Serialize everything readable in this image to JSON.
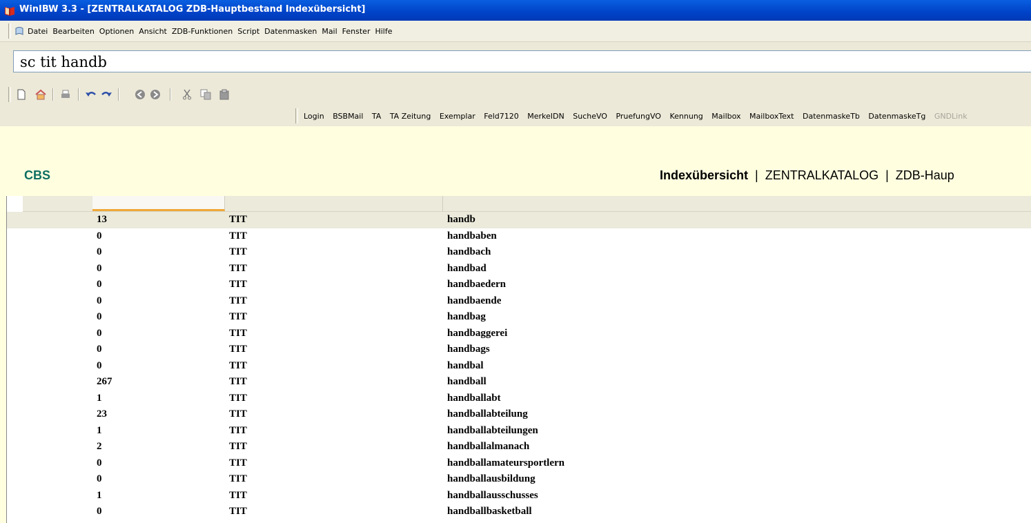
{
  "window": {
    "title": "WinIBW 3.3 - [ZENTRALKATALOG ZDB-Hauptbestand Indexübersicht]"
  },
  "menu": [
    "Datei",
    "Bearbeiten",
    "Optionen",
    "Ansicht",
    "ZDB-Funktionen",
    "Script",
    "Datenmasken",
    "Mail",
    "Fenster",
    "Hilfe"
  ],
  "command": {
    "value": "sc tit handb"
  },
  "toolbar": [
    "new-icon",
    "home-icon",
    "print-icon",
    "undo-icon",
    "redo-icon",
    "back-icon",
    "forward-icon",
    "cut-icon",
    "copy-icon",
    "paste-icon"
  ],
  "links": [
    "Login",
    "BSBMail",
    "TA",
    "TA Zeitung",
    "Exemplar",
    "Feld7120",
    "MerkeIDN",
    "SucheVO",
    "PruefungVO",
    "Kennung",
    "Mailbox",
    "MailboxText",
    "DatenmaskeTb",
    "DatenmaskeTg",
    "GNDLink"
  ],
  "content": {
    "system": "CBS",
    "breadcrumb": {
      "view": "Indexübersicht",
      "sep": "|",
      "catalog": "ZENTRALKATALOG",
      "sep2": "|",
      "database": "ZDB-Haup"
    }
  },
  "index_rows": [
    {
      "count": "13",
      "index": "TIT",
      "term": "handb"
    },
    {
      "count": "0",
      "index": "TIT",
      "term": "handbaben"
    },
    {
      "count": "0",
      "index": "TIT",
      "term": "handbach"
    },
    {
      "count": "0",
      "index": "TIT",
      "term": "handbad"
    },
    {
      "count": "0",
      "index": "TIT",
      "term": "handbaedern"
    },
    {
      "count": "0",
      "index": "TIT",
      "term": "handbaende"
    },
    {
      "count": "0",
      "index": "TIT",
      "term": "handbag"
    },
    {
      "count": "0",
      "index": "TIT",
      "term": "handbaggerei"
    },
    {
      "count": "0",
      "index": "TIT",
      "term": "handbags"
    },
    {
      "count": "0",
      "index": "TIT",
      "term": "handbal"
    },
    {
      "count": "267",
      "index": "TIT",
      "term": "handball"
    },
    {
      "count": "1",
      "index": "TIT",
      "term": "handballabt"
    },
    {
      "count": "23",
      "index": "TIT",
      "term": "handballabteilung"
    },
    {
      "count": "1",
      "index": "TIT",
      "term": "handballabteilungen"
    },
    {
      "count": "2",
      "index": "TIT",
      "term": "handballalmanach"
    },
    {
      "count": "0",
      "index": "TIT",
      "term": "handballamateursportlern"
    },
    {
      "count": "0",
      "index": "TIT",
      "term": "handballausbildung"
    },
    {
      "count": "1",
      "index": "TIT",
      "term": "handballausschusses"
    },
    {
      "count": "0",
      "index": "TIT",
      "term": "handballbasketball"
    }
  ],
  "colors": {
    "titlebar": "#0042c8",
    "cbs": "#0e6e62",
    "content_bg": "#ffffe0",
    "accent": "#f0a838"
  }
}
